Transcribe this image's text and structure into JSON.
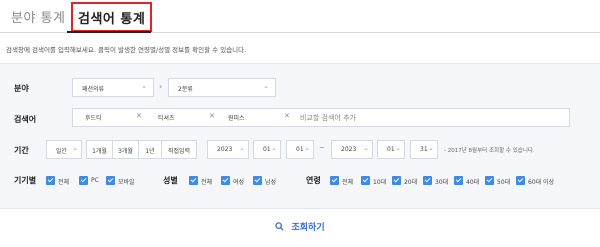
{
  "tabs": [
    {
      "label": "분야 통계",
      "active": false
    },
    {
      "label": "검색어 통계",
      "active": true
    }
  ],
  "description": "검색창에 검색어를 입력해보세요. 클릭이 발생한 연령별/성별 정보를 확인할 수 있습니다.",
  "filters": {
    "category": {
      "label": "분야",
      "first_select": "패션의류",
      "second_select": "2분류"
    },
    "keywords": {
      "label": "검색어",
      "chips": [
        "후드티",
        "티셔츠",
        "원피스"
      ],
      "placeholder": "비교할 검색어 추가"
    },
    "period": {
      "label": "기간",
      "unit_select": "일간",
      "presets": [
        "1개월",
        "3개월",
        "1년",
        "직접입력"
      ],
      "start": {
        "year": "2023",
        "month": "01",
        "day": "01"
      },
      "end": {
        "year": "2023",
        "month": "01",
        "day": "31"
      },
      "note": "- 2017년 8월부터 조회할 수 있습니다."
    },
    "device": {
      "label": "기기별",
      "options": [
        "전체",
        "PC",
        "모바일"
      ]
    },
    "gender": {
      "label": "성별",
      "options": [
        "전체",
        "여성",
        "남성"
      ]
    },
    "age": {
      "label": "연령",
      "options": [
        "전체",
        "10대",
        "20대",
        "30대",
        "40대",
        "50대",
        "60대 이상"
      ]
    }
  },
  "search_button": {
    "label": "조회하기",
    "icon": "search-icon"
  },
  "colors": {
    "accent": "#3d8ae8",
    "highlight_border": "#e2222a",
    "panel_bg": "#f5f7fb"
  }
}
